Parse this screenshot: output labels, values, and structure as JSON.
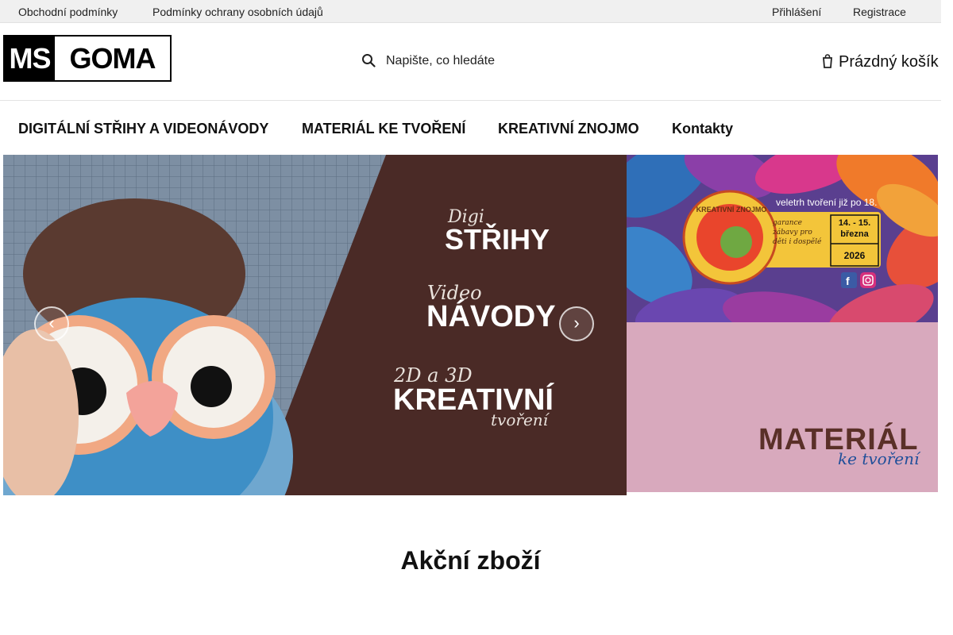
{
  "topbar": {
    "terms_link": "Obchodní podmínky",
    "privacy_link": "Podmínky ochrany osobních údajů",
    "login_link": "Přihlášení",
    "register_link": "Registrace"
  },
  "header": {
    "logo_left": "MS",
    "logo_right": "GOMA",
    "logo_icon": "msgoma-logo",
    "search_placeholder": "Napište, co hledáte",
    "search_icon": "search-icon",
    "cart_label": "Prázdný košík",
    "cart_icon": "cart-icon"
  },
  "nav": {
    "items": [
      {
        "label": "DIGITÁLNÍ STŘIHY A VIDEONÁVODY"
      },
      {
        "label": "MATERIÁL KE TVOŘENÍ"
      },
      {
        "label": "KREATIVNÍ ZNOJMO"
      },
      {
        "label": "Kontakty"
      }
    ]
  },
  "hero": {
    "line1_script": "Digi",
    "line1_bold": "STŘIHY",
    "line2_script": "Video",
    "line2_bold": "NÁVODY",
    "line3_script": "2D a 3D",
    "line3_bold": "KREATIVNÍ",
    "line3_script_after": "tvoření",
    "prev_arrow": "‹",
    "next_arrow": "›",
    "prev_icon": "chevron-left-icon",
    "next_icon": "chevron-right-icon"
  },
  "banner_top": {
    "tagline": "veletrh tvoření již po 18.",
    "badge_text": "KREATIVNÍ ZNOJMO",
    "guarantee": "garance zábavy pro děti i dospělé",
    "dates": "14. - 15.",
    "month": "března",
    "year": "2026",
    "facebook_icon": "facebook-icon",
    "instagram_icon": "instagram-icon"
  },
  "banner_bottom": {
    "title": "MATERIÁL",
    "subtitle": "ke tvoření"
  },
  "sections": {
    "sale_title": "Akční zboží"
  },
  "colors": {
    "hero_brown": "#4a2a26",
    "banner_pink": "#d8a9bd",
    "banner_text": "#5a3028",
    "badge_yellow": "#f3c53a"
  }
}
